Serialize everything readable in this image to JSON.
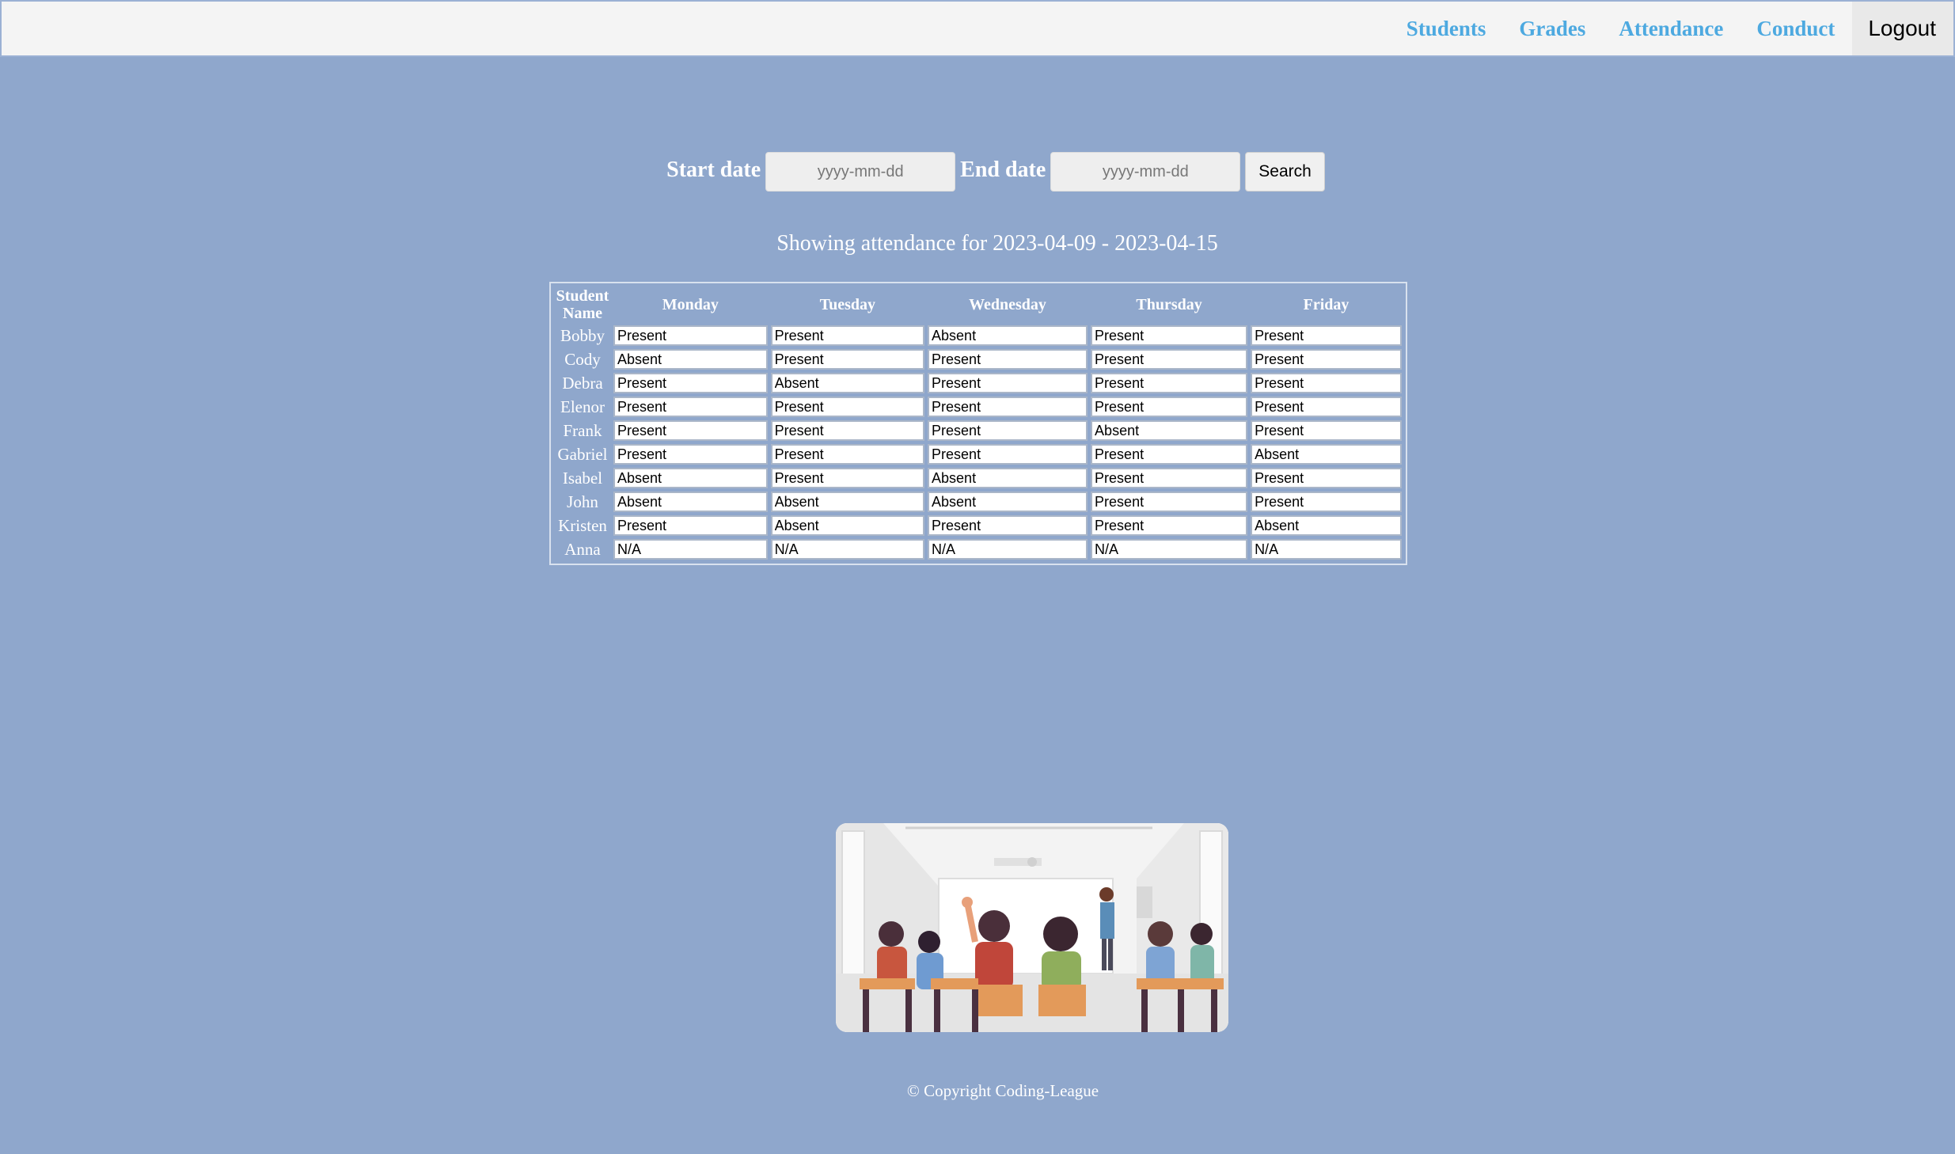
{
  "nav": {
    "students": "Students",
    "grades": "Grades",
    "attendance": "Attendance",
    "conduct": "Conduct",
    "logout": "Logout",
    "link_color": "#4da9e0"
  },
  "search": {
    "start_label": "Start date",
    "start_placeholder": "yyyy-mm-dd",
    "end_label": "End date",
    "end_placeholder": "yyyy-mm-dd",
    "button": "Search"
  },
  "range_text": "Showing attendance for 2023-04-09 - 2023-04-15",
  "table": {
    "headers": [
      "Student Name",
      "Monday",
      "Tuesday",
      "Wednesday",
      "Thursday",
      "Friday"
    ],
    "rows": [
      {
        "name": "Bobby",
        "days": [
          "Present",
          "Present",
          "Absent",
          "Present",
          "Present"
        ]
      },
      {
        "name": "Cody",
        "days": [
          "Absent",
          "Present",
          "Present",
          "Present",
          "Present"
        ]
      },
      {
        "name": "Debra",
        "days": [
          "Present",
          "Absent",
          "Present",
          "Present",
          "Present"
        ]
      },
      {
        "name": "Elenor",
        "days": [
          "Present",
          "Present",
          "Present",
          "Present",
          "Present"
        ]
      },
      {
        "name": "Frank",
        "days": [
          "Present",
          "Present",
          "Present",
          "Absent",
          "Present"
        ]
      },
      {
        "name": "Gabriel",
        "days": [
          "Present",
          "Present",
          "Present",
          "Present",
          "Absent"
        ]
      },
      {
        "name": "Isabel",
        "days": [
          "Absent",
          "Present",
          "Absent",
          "Present",
          "Present"
        ]
      },
      {
        "name": "John",
        "days": [
          "Absent",
          "Absent",
          "Absent",
          "Present",
          "Present"
        ]
      },
      {
        "name": "Kristen",
        "days": [
          "Present",
          "Absent",
          "Present",
          "Present",
          "Absent"
        ]
      },
      {
        "name": "Anna",
        "days": [
          "N/A",
          "N/A",
          "N/A",
          "N/A",
          "N/A"
        ]
      }
    ]
  },
  "illustration": {
    "icon": "classroom-illustration"
  },
  "footer": {
    "copyright": "© Copyright Coding-League"
  },
  "colors": {
    "background": "#8fa7cc",
    "navbar": "#f4f4f4"
  }
}
